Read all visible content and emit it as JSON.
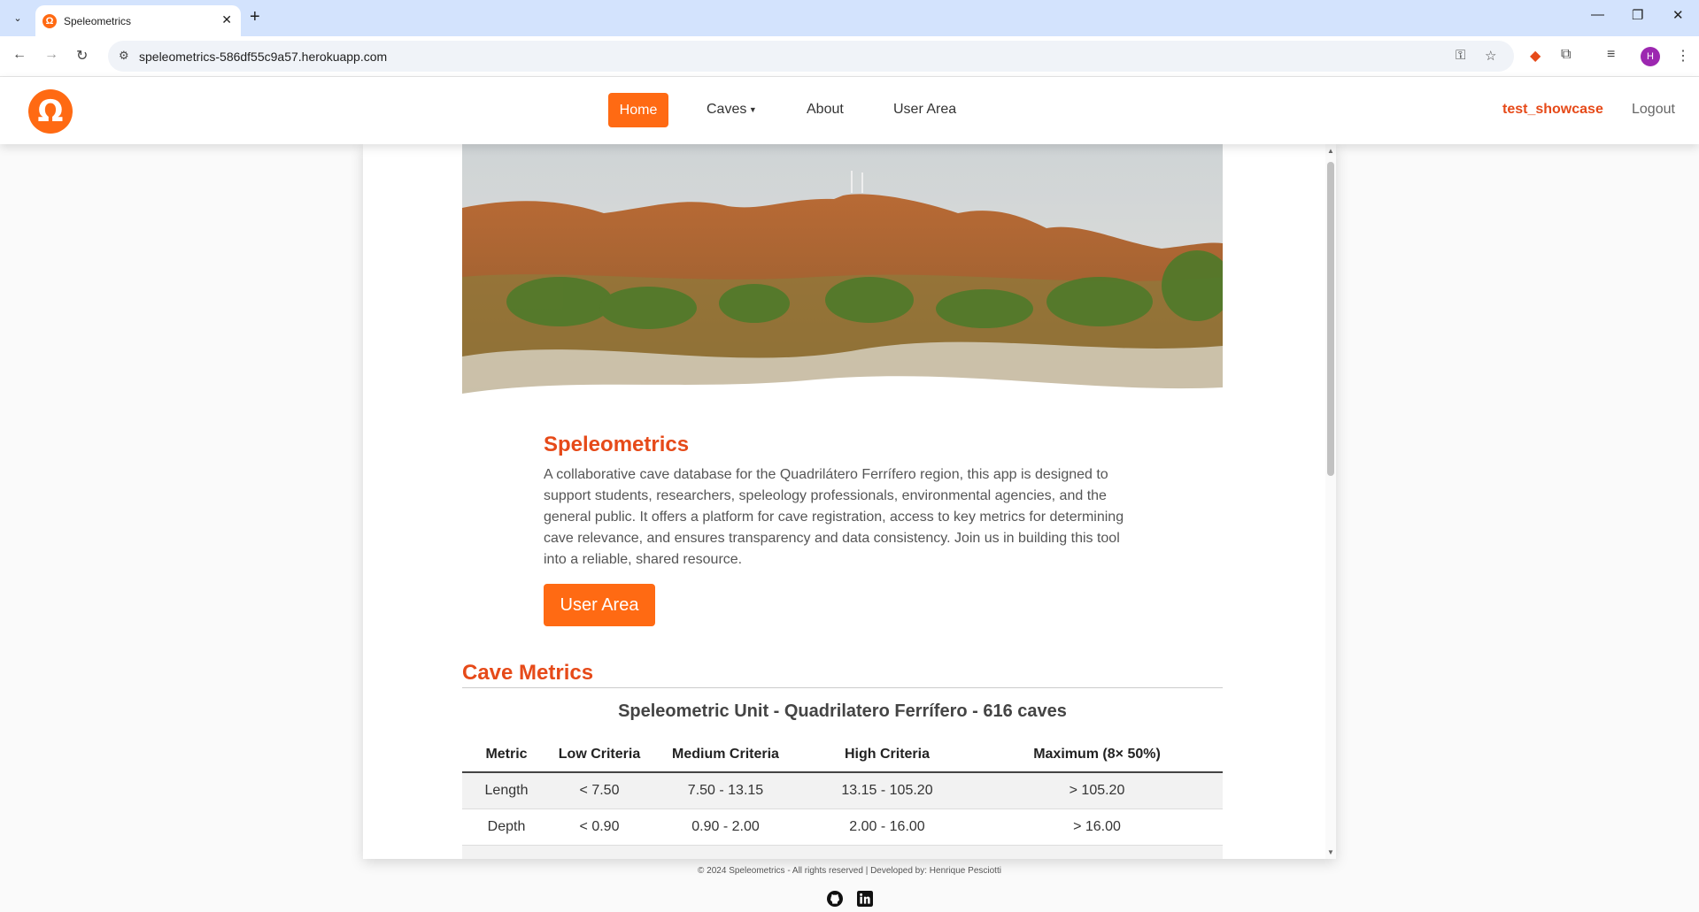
{
  "browser": {
    "tab_title": "Speleometrics",
    "url": "speleometrics-586df55c9a57.herokuapp.com",
    "avatar_initial": "H"
  },
  "nav": {
    "logo_glyph": "Ω",
    "home": "Home",
    "caves": "Caves",
    "about": "About",
    "user_area": "User Area",
    "username": "test_showcase",
    "logout": "Logout"
  },
  "intro": {
    "title": "Speleometrics",
    "text": "A collaborative cave database for the Quadrilátero Ferrífero region, this app is designed to support students, researchers, speleology professionals, environmental agencies, and the general public. It offers a platform for cave registration, access to key metrics for determining cave relevance, and ensures transparency and data consistency. Join us in building this tool into a reliable, shared resource.",
    "button": "User Area"
  },
  "metrics": {
    "title": "Cave Metrics",
    "unit_title": "Speleometric Unit - Quadrilatero Ferrífero - 616 caves",
    "headers": [
      "Metric",
      "Low Criteria",
      "Medium Criteria",
      "High Criteria",
      "Maximum (8× 50%)"
    ],
    "rows": [
      [
        "Length",
        "< 7.50",
        "7.50 - 13.15",
        "13.15 - 105.20",
        "> 105.20"
      ],
      [
        "Depth",
        "< 0.90",
        "0.90 - 2.00",
        "2.00 - 16.00",
        "> 16.00"
      ]
    ]
  },
  "footer": {
    "text": "© 2024 Speleometrics - All rights reserved | Developed by: Henrique Pesciotti"
  },
  "colors": {
    "accent": "#ff6a13",
    "title": "#e64a19"
  }
}
